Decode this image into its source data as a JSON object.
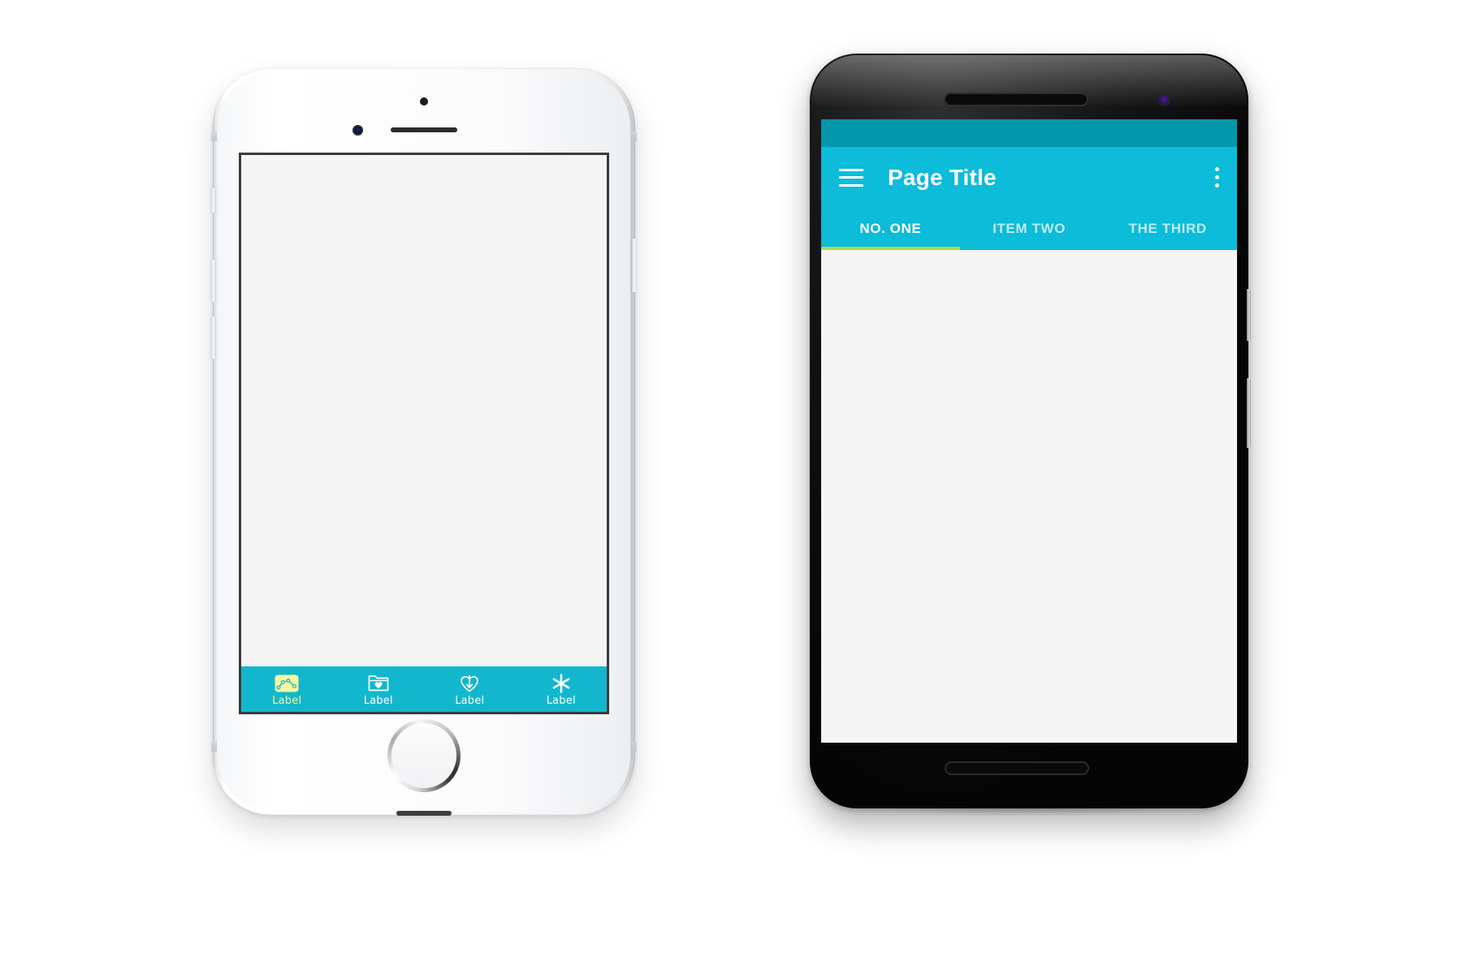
{
  "scene": {
    "background_color": "#ffffff",
    "description": "Two mobile device mockups side by side"
  },
  "iphone": {
    "device_name": "White iPhone",
    "frame_color": "#ffffff",
    "screen_background": "#f5f5f5",
    "hardware": {
      "speaker": "earpiece-speaker",
      "camera": "front-camera",
      "sensor": "proximity-sensor",
      "home_button": "home-button",
      "buttons": [
        "mute-switch",
        "volume-up",
        "volume-down",
        "power-button"
      ]
    },
    "tab_bar": {
      "background_color": "#12b7cd",
      "active_color": "#f7f9a0",
      "inactive_color": "#ffffff",
      "items": [
        {
          "icon": "line-chart-icon",
          "label": "Label",
          "active": true
        },
        {
          "icon": "folder-heart-icon",
          "label": "Label",
          "active": false
        },
        {
          "icon": "heart-arrow-down-icon",
          "label": "Label",
          "active": false
        },
        {
          "icon": "asterisk-icon",
          "label": "Label",
          "active": false
        }
      ]
    }
  },
  "android": {
    "device_name": "Black Android Phone",
    "frame_color": "#000000",
    "screen_background": "#f5f5f5",
    "hardware": {
      "speaker_top": "earpiece-speaker",
      "speaker_bottom": "bottom-speaker",
      "camera": "front-camera",
      "buttons": [
        "power-button",
        "volume-rocker"
      ]
    },
    "status_bar": {
      "color": "#0497ac"
    },
    "app_bar": {
      "color": "#0cbcd8",
      "menu_icon": "hamburger-menu-icon",
      "title": "Page Title",
      "overflow_icon": "more-vert-icon",
      "text_color": "#ffffff"
    },
    "tabs": {
      "indicator_color": "#b5d94b",
      "active_index": 0,
      "items": [
        {
          "label": "NO. ONE",
          "active": true
        },
        {
          "label": "ITEM TWO",
          "active": false
        },
        {
          "label": "THE THIRD",
          "active": false
        }
      ]
    }
  }
}
